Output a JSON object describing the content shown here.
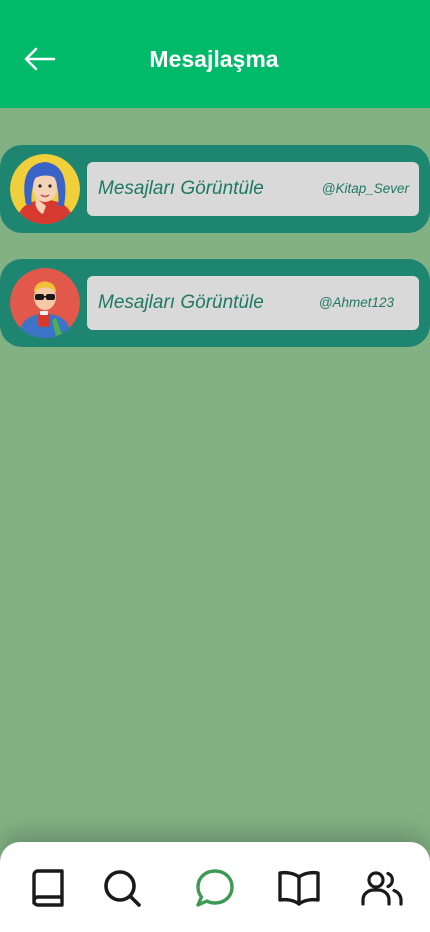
{
  "header": {
    "title": "Mesajlaşma",
    "back_icon": "arrow-left-icon"
  },
  "conversations": [
    {
      "action_label": "Mesajları Görüntüle",
      "handle": "@Kitap_Sever",
      "avatar": "avatar-woman-blue-hair"
    },
    {
      "action_label": "Mesajları Görüntüle",
      "handle": "@Ahmet123",
      "avatar": "avatar-man-sunglasses"
    }
  ],
  "nav": {
    "items": [
      {
        "icon": "book-icon",
        "active": false
      },
      {
        "icon": "search-icon",
        "active": false
      },
      {
        "icon": "chat-bubble-icon",
        "active": true
      },
      {
        "icon": "open-book-icon",
        "active": false
      },
      {
        "icon": "users-icon",
        "active": false
      }
    ]
  },
  "colors": {
    "header": "#00ba6a",
    "background": "#82b284",
    "card": "#1e8570",
    "button": "#d9d9d9",
    "text_accent": "#1e7a5e",
    "nav_active": "#3d9a55"
  }
}
